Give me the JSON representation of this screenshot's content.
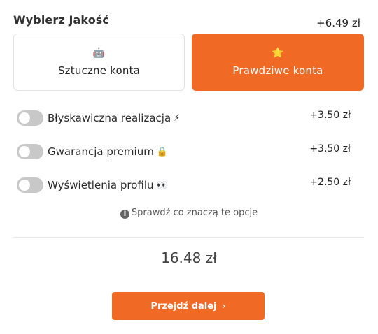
{
  "quality": {
    "title": "Wybierz Jakość",
    "price": "+6.49 zł",
    "options": [
      {
        "icon": "🤖",
        "label": "Sztuczne konta",
        "selected": false
      },
      {
        "icon": "⭐",
        "label": "Prawdziwe konta",
        "selected": true
      }
    ]
  },
  "addons": [
    {
      "label": "Błyskawiczna realizacja",
      "emoji": "⚡",
      "price": "+3.50 zł",
      "enabled": false
    },
    {
      "label": "Gwarancja premium",
      "emoji": "🔒",
      "price": "+3.50 zł",
      "enabled": false
    },
    {
      "label": "Wyświetlenia profilu",
      "emoji": "👀",
      "price": "+2.50 zł",
      "enabled": false
    }
  ],
  "info": {
    "icon": "info-icon",
    "text": "Sprawdź co znaczą te opcje"
  },
  "total": "16.48 zł",
  "next_button": {
    "label": "Przejdź dalej",
    "icon": "›"
  },
  "colors": {
    "accent": "#f06a25",
    "toggle_off": "#c8c8c8",
    "border": "#e3e3e3"
  }
}
